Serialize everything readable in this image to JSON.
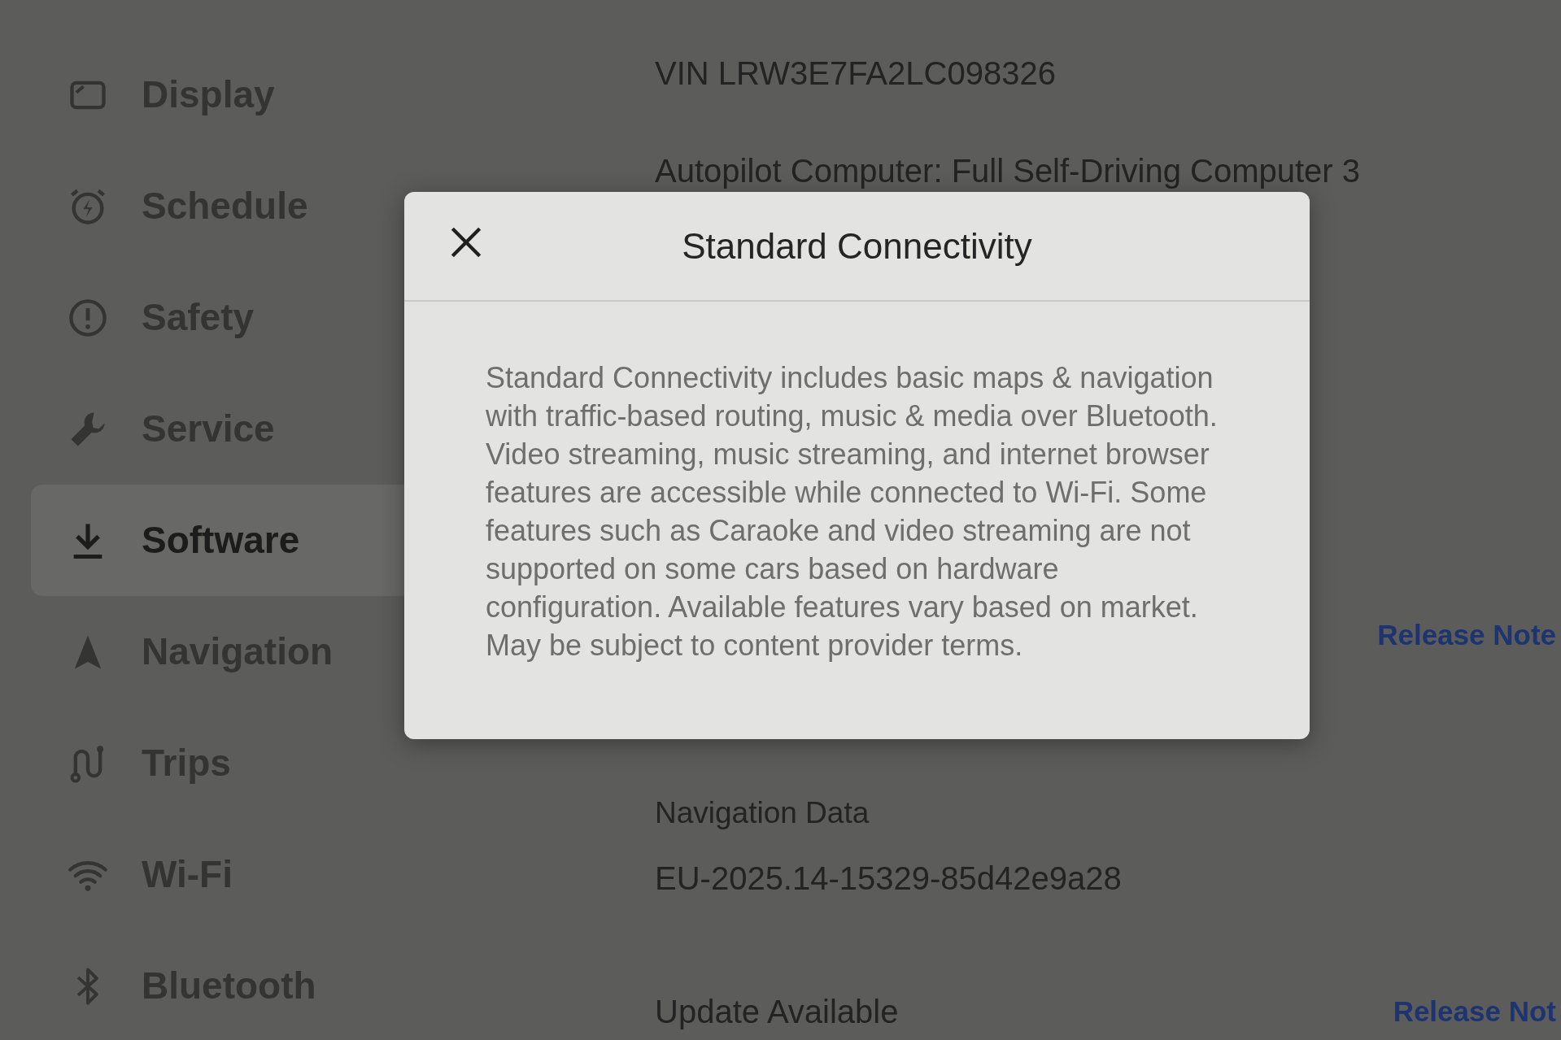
{
  "sidebar": {
    "items": [
      {
        "label": "Display",
        "selected": false
      },
      {
        "label": "Schedule",
        "selected": false
      },
      {
        "label": "Safety",
        "selected": false
      },
      {
        "label": "Service",
        "selected": false
      },
      {
        "label": "Software",
        "selected": true
      },
      {
        "label": "Navigation",
        "selected": false
      },
      {
        "label": "Trips",
        "selected": false
      },
      {
        "label": "Wi-Fi",
        "selected": false
      },
      {
        "label": "Bluetooth",
        "selected": false
      }
    ]
  },
  "vehicle_info": {
    "vin": "VIN LRW3E7FA2LC098326",
    "autopilot_computer": "Autopilot Computer: Full Self-Driving Computer 3"
  },
  "current_version": {
    "release_notes_link": "Release Note"
  },
  "navigation_data": {
    "heading": "Navigation Data",
    "value": "EU-2025.14-15329-85d42e9a28"
  },
  "update": {
    "heading": "Update Available",
    "release_notes_link": "Release Not"
  },
  "dialog": {
    "title": "Standard Connectivity",
    "body": "Standard Connectivity includes basic maps & navigation with traffic-based routing, music & media over Bluetooth. Video streaming, music streaming, and internet browser features are accessible while connected to Wi-Fi. Some features such as Caraoke and video streaming are not supported on some cars based on hardware configuration. Available features vary based on market. May be subject to content provider terms."
  }
}
